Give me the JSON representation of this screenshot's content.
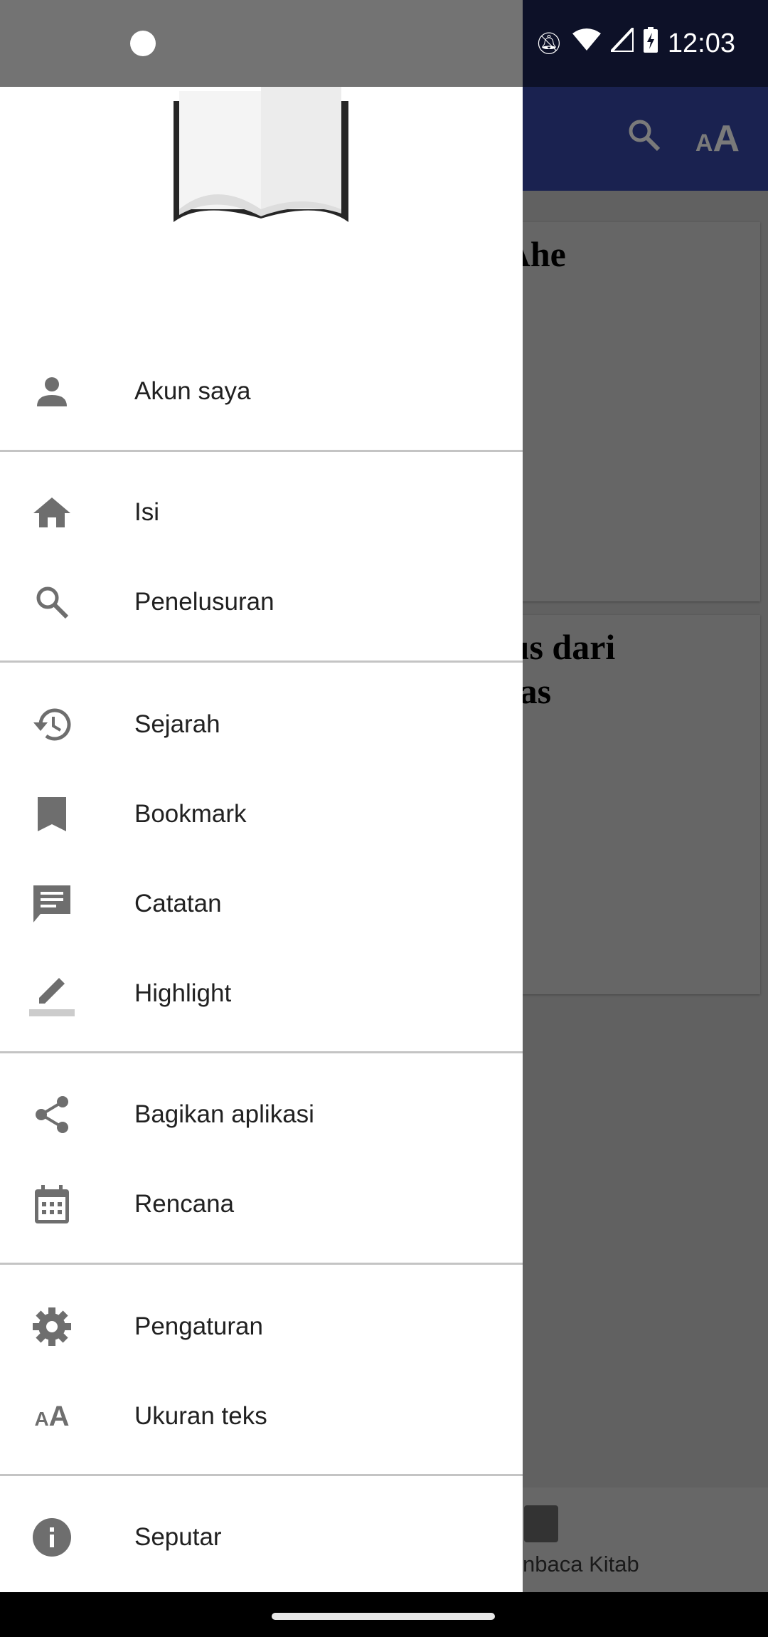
{
  "status_bar": {
    "time": "12:03",
    "icons": [
      "app-notification-icon",
      "bell-off-icon",
      "wifi-icon",
      "signal-icon",
      "battery-charging-icon"
    ]
  },
  "app_bar": {
    "actions": [
      "search-icon",
      "text-size-icon"
    ]
  },
  "content": {
    "cards": [
      {
        "title": "o Ahe\nin"
      },
      {
        "title": "esus dari\nukas"
      }
    ]
  },
  "bottom_nav": {
    "item_label": "nbaca Kitab",
    "item_icon": "calendar-icon"
  },
  "drawer": {
    "logo": "open-book-icon",
    "groups": [
      [
        {
          "label": "Akun saya",
          "icon": "person-icon"
        }
      ],
      [
        {
          "label": "Isi",
          "icon": "home-icon"
        },
        {
          "label": "Penelusuran",
          "icon": "search-icon"
        }
      ],
      [
        {
          "label": "Sejarah",
          "icon": "history-icon"
        },
        {
          "label": "Bookmark",
          "icon": "bookmark-icon"
        },
        {
          "label": "Catatan",
          "icon": "note-icon"
        },
        {
          "label": "Highlight",
          "icon": "highlight-icon"
        }
      ],
      [
        {
          "label": "Bagikan aplikasi",
          "icon": "share-icon"
        },
        {
          "label": "Rencana",
          "icon": "calendar-icon"
        }
      ],
      [
        {
          "label": "Pengaturan",
          "icon": "gear-icon"
        },
        {
          "label": "Ukuran teks",
          "icon": "text-size-icon"
        }
      ],
      [
        {
          "label": "Seputar",
          "icon": "info-icon"
        }
      ]
    ]
  },
  "colors": {
    "app_bar": "#1a2250",
    "status_bar": "#0d1128",
    "scrim": "#616161",
    "icon": "#6e6e6e"
  }
}
